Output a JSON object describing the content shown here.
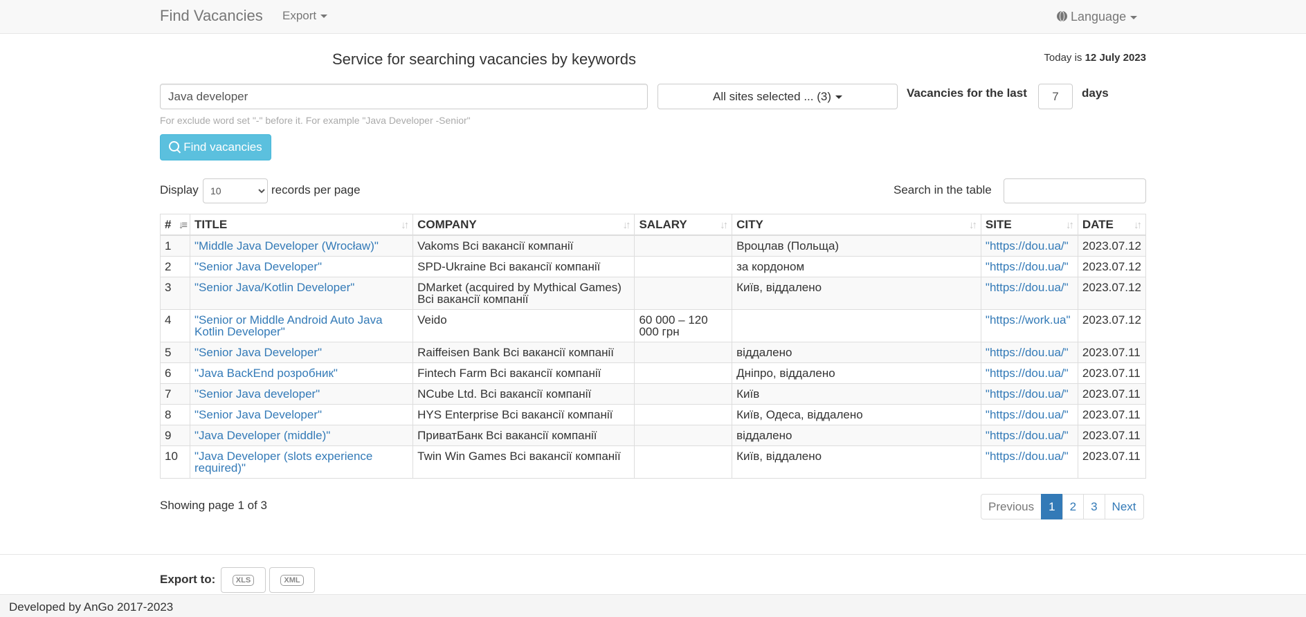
{
  "navbar": {
    "brand": "Find Vacancies",
    "export_menu": "Export",
    "language_menu": "Language"
  },
  "header": {
    "service_title": "Service for searching vacancies by keywords",
    "today_prefix": "Today is",
    "today_date": "12 July 2023"
  },
  "search": {
    "keywords_value": "Java developer",
    "sites_label": "All sites selected ... (3)",
    "last_label": "Vacancies for the last",
    "days_value": "7",
    "days_label": "days",
    "hint": "For exclude word set \"-\" before it. For example \"Java Developer -Senior\"",
    "find_button": "Find vacancies"
  },
  "table_controls": {
    "display_label": "Display",
    "per_page_value": "10",
    "records_label": "records per page",
    "search_label": "Search in the table",
    "search_value": ""
  },
  "table": {
    "columns": [
      "#",
      "TITLE",
      "COMPANY",
      "SALARY",
      "CITY",
      "SITE",
      "DATE"
    ],
    "rows": [
      {
        "n": "1",
        "title": "\"Middle Java Developer (Wrocław)\"",
        "company": "Vakoms Всі вакансії компанії",
        "salary": "",
        "city": "Вроцлав (Польща)",
        "site": "\"https://dou.ua/\"",
        "date": "2023.07.12"
      },
      {
        "n": "2",
        "title": "\"Senior Java Developer\"",
        "company": "SPD-Ukraine Всі вакансії компанії",
        "salary": "",
        "city": "за кордоном",
        "site": "\"https://dou.ua/\"",
        "date": "2023.07.12"
      },
      {
        "n": "3",
        "title": "\"Senior Java/Kotlin Developer\"",
        "company": "DMarket (acquired by Mythical Games) Всі вакансії компанії",
        "salary": "",
        "city": "Київ, віддалено",
        "site": "\"https://dou.ua/\"",
        "date": "2023.07.12"
      },
      {
        "n": "4",
        "title": "\"Senior or Middle Android Auto Java Kotlin Developer\"",
        "company": "Veido",
        "salary": "60 000 – 120 000 грн",
        "city": "",
        "site": "\"https://work.ua\"",
        "date": "2023.07.12"
      },
      {
        "n": "5",
        "title": "\"Senior Java Developer\"",
        "company": "Raiffeisen Bank Всі вакансії компанії",
        "salary": "",
        "city": "віддалено",
        "site": "\"https://dou.ua/\"",
        "date": "2023.07.11"
      },
      {
        "n": "6",
        "title": "\"Java BackEnd розробник\"",
        "company": "Fintech Farm Всі вакансії компанії",
        "salary": "",
        "city": "Дніпро, віддалено",
        "site": "\"https://dou.ua/\"",
        "date": "2023.07.11"
      },
      {
        "n": "7",
        "title": "\"Senior Java developer\"",
        "company": "NCube Ltd. Всі вакансії компанії",
        "salary": "",
        "city": "Київ",
        "site": "\"https://dou.ua/\"",
        "date": "2023.07.11"
      },
      {
        "n": "8",
        "title": "\"Senior Java Developer\"",
        "company": "HYS Enterprise Всі вакансії компанії",
        "salary": "",
        "city": "Київ, Одеса, віддалено",
        "site": "\"https://dou.ua/\"",
        "date": "2023.07.11"
      },
      {
        "n": "9",
        "title": "\"Java Developer (middle)\"",
        "company": "ПриватБанк Всі вакансії компанії",
        "salary": "",
        "city": "віддалено",
        "site": "\"https://dou.ua/\"",
        "date": "2023.07.11"
      },
      {
        "n": "10",
        "title": "\"Java Developer (slots experience required)\"",
        "company": "Twin Win Games Всі вакансії компанії",
        "salary": "",
        "city": "Київ, віддалено",
        "site": "\"https://dou.ua/\"",
        "date": "2023.07.11"
      }
    ]
  },
  "pagination": {
    "showing": "Showing page 1 of 3",
    "previous": "Previous",
    "pages": [
      "1",
      "2",
      "3"
    ],
    "next": "Next"
  },
  "export": {
    "label": "Export to:",
    "xls": "XLS",
    "xml": "XML"
  },
  "footer": {
    "text": "Developed by AnGo 2017-2023"
  },
  "colors": {
    "link": "#337ab7",
    "find_button": "#5bc0de",
    "active_page": "#337ab7"
  }
}
